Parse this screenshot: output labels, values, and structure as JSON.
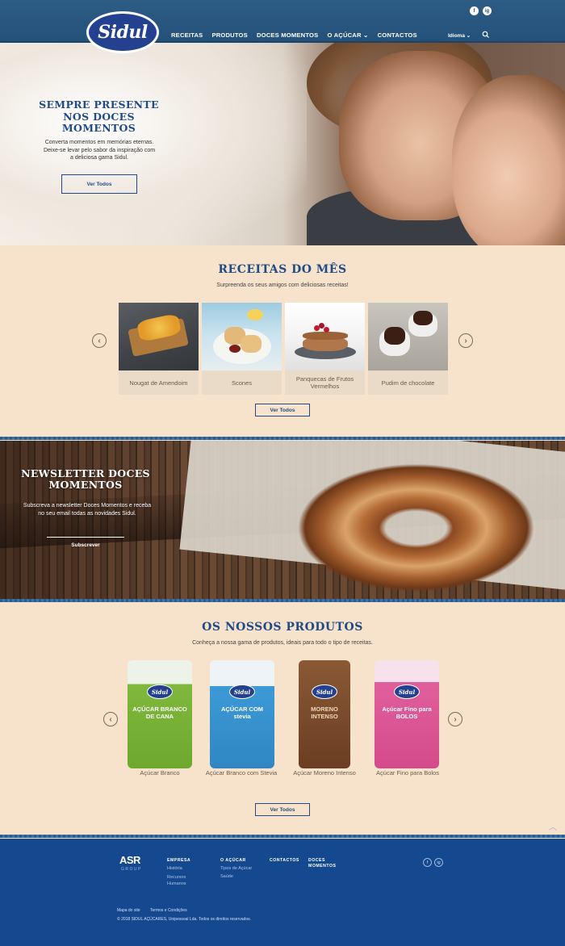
{
  "header": {
    "logo_text": "Sidul",
    "nav": [
      "RECEITAS",
      "PRODUTOS",
      "DOCES MOMENTOS",
      "O AÇÚCAR",
      "CONTACTOS"
    ],
    "lang_label": "Idioma",
    "social": [
      "f",
      "ig"
    ]
  },
  "hero": {
    "title": "SEMPRE PRESENTE NOS DOCES MOMENTOS",
    "text": "Converta momentos em memórias eternas. Deixe-se levar pelo sabor da inspiração com a deliciosa gama Sidul.",
    "button": "Ver Todos"
  },
  "recipes": {
    "title": "RECEITAS DO MÊS",
    "subtitle": "Surpreenda os seus amigos com deliciosas receitas!",
    "items": [
      "Nougat de Amendoim",
      "Scones",
      "Panquecas de Frutos Vermelhos",
      "Pudim de chocolate"
    ],
    "button": "Ver Todos"
  },
  "newsletter": {
    "title": "NEWSLETTER DOCES MOMENTOS",
    "text": "Subscreva a newsletter Doces Momentos e receba no seu email todas as novidades Sidul.",
    "button": "Subscrever"
  },
  "products": {
    "title": "OS NOSSOS PRODUTOS",
    "subtitle": "Conheça a nossa gama de produtos, ideais para todo o tipo de receitas.",
    "items": [
      {
        "label": "Açúcar Branco",
        "pack_text": "AÇÚCAR BRANCO DE CANA",
        "color": "#7fb83c"
      },
      {
        "label": "Açúcar Branco com Stevia",
        "pack_text": "AÇÚCAR COM stevia",
        "color": "#3d9ad6"
      },
      {
        "label": "Açúcar Moreno Intenso",
        "pack_text": "MORENO INTENSO",
        "color": "#6b3d22"
      },
      {
        "label": "Açúcar Fino para Bolos",
        "pack_text": "Açúcar Fino para BOLOS",
        "color": "#e05f9c"
      }
    ],
    "button": "Ver Todos"
  },
  "footer": {
    "brand": "ASR",
    "brand_sub": "GROUP",
    "col1_title": "EMPRESA",
    "col1_links": [
      "História",
      "Recursos Humanos"
    ],
    "col2_title": "O AÇÚCAR",
    "col2_links": [
      "Tipos de Açúcar",
      "Saúde"
    ],
    "col3_title": "CONTACTOS",
    "col4_title": "DOCES MOMENTOS",
    "legal": [
      "Mapa do site",
      "Termos e Condições"
    ],
    "copyright": "© 2018 SIDUL AÇÚCARES, Unipessoal Lda. Todos os direitos reservados."
  }
}
